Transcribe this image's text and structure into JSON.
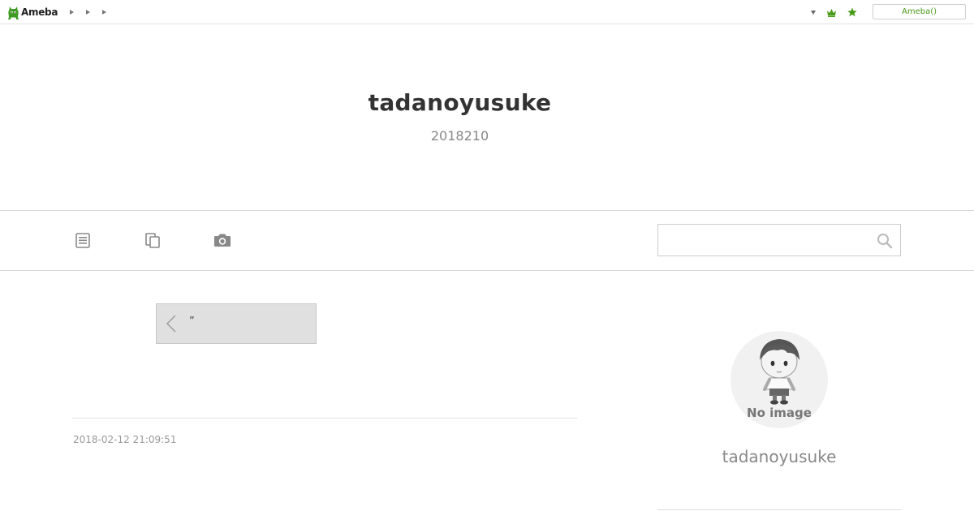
{
  "topbar": {
    "logo_text": "Ameba",
    "breadcrumb_count": 3,
    "account_button_label": "Ameba()",
    "accent_color": "#4a9a1a"
  },
  "header": {
    "blog_title": "tadanoyusuke",
    "blog_description": "2018210"
  },
  "nav": {
    "items": [
      {
        "icon": "article-list-icon"
      },
      {
        "icon": "copy-pages-icon"
      },
      {
        "icon": "camera-icon"
      }
    ],
    "search": {
      "value": "",
      "placeholder": "",
      "icon": "search-icon"
    }
  },
  "main": {
    "prev_entry": {
      "icon": "chevron-left-icon",
      "label": "”"
    },
    "post_date": "2018-02-12 21:09:51"
  },
  "sidebar": {
    "avatar": {
      "label": "No image"
    },
    "profile_name": "tadanoyusuke"
  }
}
